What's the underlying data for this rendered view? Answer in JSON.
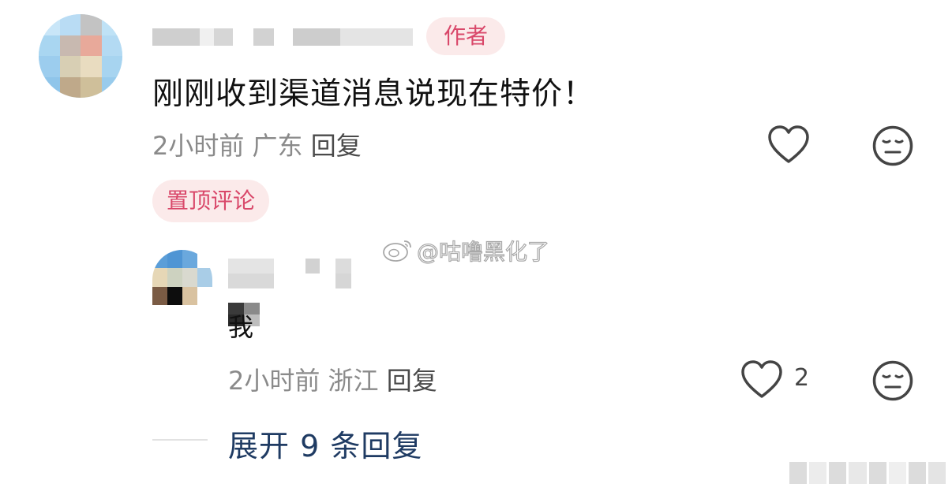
{
  "comment": {
    "author_badge": "作者",
    "text": "刚刚收到渠道消息说现在特价！",
    "time": "2小时前",
    "location": "广东",
    "reply_label": "回复",
    "pinned_badge": "置顶评论"
  },
  "reply": {
    "text": "我",
    "time": "2小时前",
    "location": "浙江",
    "reply_label": "回复",
    "like_count": "2"
  },
  "expand_replies": "展开 9 条回复",
  "watermark": "@咕噜黑化了",
  "colors": {
    "badge_background": "#fbeaea",
    "badge_text": "#d9486a",
    "meta_text": "#8a8a8a",
    "link_text": "#1f3b63"
  },
  "icons": {
    "like": "heart-outline-icon",
    "dislike": "neutral-face-icon",
    "watermark_logo": "weibo-logo-icon"
  }
}
